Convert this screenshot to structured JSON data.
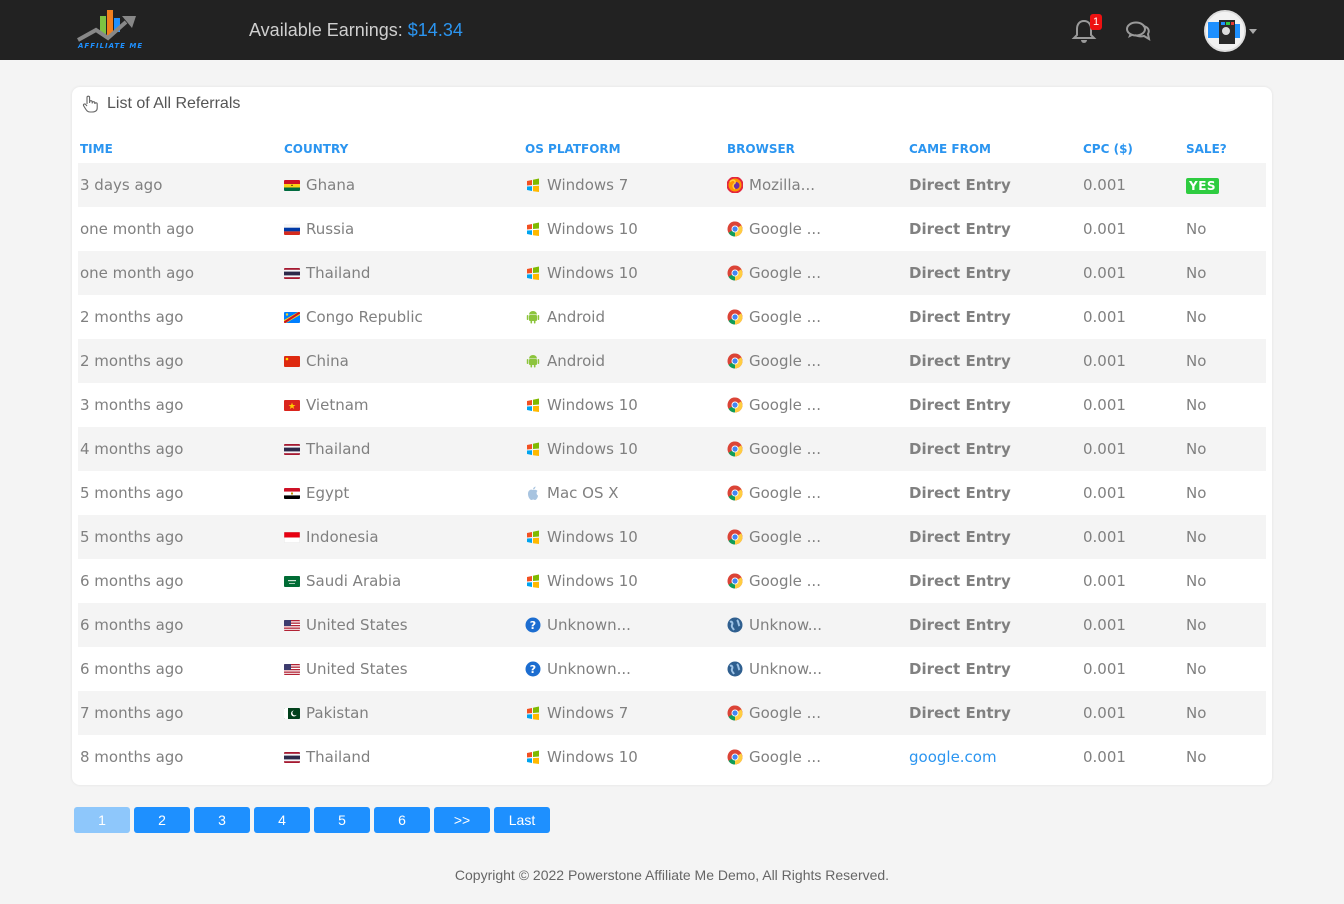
{
  "header": {
    "logo_text": "AFFILIATE ME",
    "earnings_label": "Available Earnings:",
    "earnings_amount": "$14.34",
    "notification_count": "1",
    "icons": {
      "notifications": "bell-icon",
      "messages": "chat-icon",
      "avatar": "user-avatar",
      "dropdown": "caret-down-icon"
    }
  },
  "panel": {
    "title": "List of All Referrals",
    "title_icon": "hand-pointer-icon"
  },
  "table": {
    "columns": [
      "TIME",
      "COUNTRY",
      "OS PLATFORM",
      "BROWSER",
      "CAME FROM",
      "CPC ($)",
      "SALE?"
    ],
    "rows": [
      {
        "time": "3 days ago",
        "country": "Ghana",
        "flag": "gh",
        "os": "Windows 7",
        "os_icon": "windows",
        "browser": "Mozilla...",
        "browser_icon": "firefox",
        "came_from": "Direct Entry",
        "came_from_link": false,
        "cpc": "0.001",
        "sale": "YES"
      },
      {
        "time": "one month ago",
        "country": "Russia",
        "flag": "ru",
        "os": "Windows 10",
        "os_icon": "windows",
        "browser": "Google ...",
        "browser_icon": "chrome",
        "came_from": "Direct Entry",
        "came_from_link": false,
        "cpc": "0.001",
        "sale": "No"
      },
      {
        "time": "one month ago",
        "country": "Thailand",
        "flag": "th",
        "os": "Windows 10",
        "os_icon": "windows",
        "browser": "Google ...",
        "browser_icon": "chrome",
        "came_from": "Direct Entry",
        "came_from_link": false,
        "cpc": "0.001",
        "sale": "No"
      },
      {
        "time": "2 months ago",
        "country": "Congo Republic",
        "flag": "cd",
        "os": "Android",
        "os_icon": "android",
        "browser": "Google ...",
        "browser_icon": "chrome",
        "came_from": "Direct Entry",
        "came_from_link": false,
        "cpc": "0.001",
        "sale": "No"
      },
      {
        "time": "2 months ago",
        "country": "China",
        "flag": "cn",
        "os": "Android",
        "os_icon": "android",
        "browser": "Google ...",
        "browser_icon": "chrome",
        "came_from": "Direct Entry",
        "came_from_link": false,
        "cpc": "0.001",
        "sale": "No"
      },
      {
        "time": "3 months ago",
        "country": "Vietnam",
        "flag": "vn",
        "os": "Windows 10",
        "os_icon": "windows",
        "browser": "Google ...",
        "browser_icon": "chrome",
        "came_from": "Direct Entry",
        "came_from_link": false,
        "cpc": "0.001",
        "sale": "No"
      },
      {
        "time": "4 months ago",
        "country": "Thailand",
        "flag": "th",
        "os": "Windows 10",
        "os_icon": "windows",
        "browser": "Google ...",
        "browser_icon": "chrome",
        "came_from": "Direct Entry",
        "came_from_link": false,
        "cpc": "0.001",
        "sale": "No"
      },
      {
        "time": "5 months ago",
        "country": "Egypt",
        "flag": "eg",
        "os": "Mac OS X",
        "os_icon": "apple",
        "browser": "Google ...",
        "browser_icon": "chrome",
        "came_from": "Direct Entry",
        "came_from_link": false,
        "cpc": "0.001",
        "sale": "No"
      },
      {
        "time": "5 months ago",
        "country": "Indonesia",
        "flag": "id",
        "os": "Windows 10",
        "os_icon": "windows",
        "browser": "Google ...",
        "browser_icon": "chrome",
        "came_from": "Direct Entry",
        "came_from_link": false,
        "cpc": "0.001",
        "sale": "No"
      },
      {
        "time": "6 months ago",
        "country": "Saudi Arabia",
        "flag": "sa",
        "os": "Windows 10",
        "os_icon": "windows",
        "browser": "Google ...",
        "browser_icon": "chrome",
        "came_from": "Direct Entry",
        "came_from_link": false,
        "cpc": "0.001",
        "sale": "No"
      },
      {
        "time": "6 months ago",
        "country": "United States",
        "flag": "us",
        "os": "Unknown...",
        "os_icon": "unknown",
        "browser": " Unknow...",
        "browser_icon": "globe",
        "came_from": "Direct Entry",
        "came_from_link": false,
        "cpc": "0.001",
        "sale": "No"
      },
      {
        "time": "6 months ago",
        "country": "United States",
        "flag": "us",
        "os": "Unknown...",
        "os_icon": "unknown",
        "browser": " Unknow...",
        "browser_icon": "globe",
        "came_from": "Direct Entry",
        "came_from_link": false,
        "cpc": "0.001",
        "sale": "No"
      },
      {
        "time": "7 months ago",
        "country": "Pakistan",
        "flag": "pk",
        "os": "Windows 7",
        "os_icon": "windows",
        "browser": "Google ...",
        "browser_icon": "chrome",
        "came_from": "Direct Entry",
        "came_from_link": false,
        "cpc": "0.001",
        "sale": "No"
      },
      {
        "time": "8 months ago",
        "country": "Thailand",
        "flag": "th",
        "os": "Windows 10",
        "os_icon": "windows",
        "browser": "Google ...",
        "browser_icon": "chrome",
        "came_from": "google.com",
        "came_from_link": true,
        "cpc": "0.001",
        "sale": "No"
      }
    ]
  },
  "pagination": {
    "current": "1",
    "pages": [
      "1",
      "2",
      "3",
      "4",
      "5",
      "6",
      ">>",
      "Last"
    ]
  },
  "footer": {
    "text": "Copyright © 2022 Powerstone Affiliate Me Demo, All Rights Reserved."
  },
  "colors": {
    "accent": "#1e90ff",
    "header_bg": "#222222",
    "sale_yes": "#2ecc40",
    "notification_badge": "#ee1111"
  }
}
